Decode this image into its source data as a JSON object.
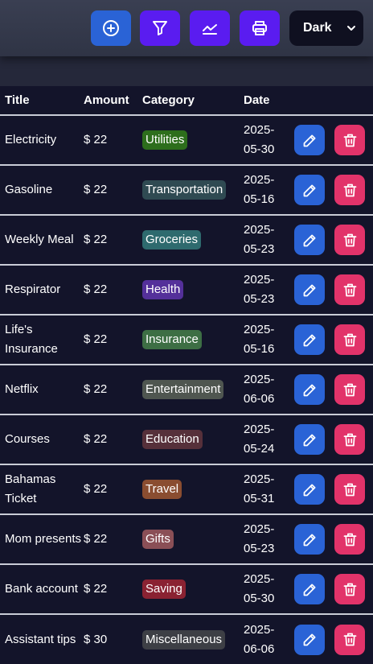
{
  "toolbar": {
    "buttons": [
      {
        "name": "add",
        "icon": "plus-circle-icon",
        "color": "#2a63d6"
      },
      {
        "name": "filter",
        "icon": "filter-icon",
        "color": "#5a1cf0"
      },
      {
        "name": "chart",
        "icon": "chart-line-icon",
        "color": "#5a1cf0"
      },
      {
        "name": "print",
        "icon": "printer-icon",
        "color": "#5a1cf0"
      }
    ],
    "theme_select": {
      "value": "Dark",
      "icon": "chevron-down-icon"
    }
  },
  "table": {
    "headers": {
      "title": "Title",
      "amount": "Amount",
      "category": "Category",
      "date": "Date"
    },
    "rows": [
      {
        "title": "Electricity",
        "amount": "$ 22",
        "category": "Utilities",
        "category_color": "#2d6e1c",
        "date_year": "2025-",
        "date_md": "05-30"
      },
      {
        "title": "Gasoline",
        "amount": "$ 22",
        "category": "Transportation",
        "category_color": "#2f4a52",
        "date_year": "2025-",
        "date_md": "05-16"
      },
      {
        "title": "Weekly Meal",
        "amount": "$ 22",
        "category": "Groceries",
        "category_color": "#2e6a6e",
        "date_year": "2025-",
        "date_md": "05-23"
      },
      {
        "title": "Respirator",
        "amount": "$ 22",
        "category": "Health",
        "category_color": "#54309a",
        "date_year": "2025-",
        "date_md": "05-23"
      },
      {
        "title": "Life's Insurance",
        "amount": "$ 22",
        "category": "Insurance",
        "category_color": "#3d6e44",
        "date_year": "2025-",
        "date_md": "05-16"
      },
      {
        "title": "Netflix",
        "amount": "$ 22",
        "category": "Entertainment",
        "category_color": "#4f5650",
        "date_year": "2025-",
        "date_md": "06-06"
      },
      {
        "title": "Courses",
        "amount": "$ 22",
        "category": "Education",
        "category_color": "#56303a",
        "date_year": "2025-",
        "date_md": "05-24"
      },
      {
        "title": "Bahamas Ticket",
        "amount": "$ 22",
        "category": "Travel",
        "category_color": "#8a4d30",
        "date_year": "2025-",
        "date_md": "05-31"
      },
      {
        "title": "Mom presents",
        "amount": "$ 22",
        "category": "Gifts",
        "category_color": "#8a4f56",
        "date_year": "2025-",
        "date_md": "05-23"
      },
      {
        "title": "Bank account",
        "amount": "$ 22",
        "category": "Saving",
        "category_color": "#8a2232",
        "date_year": "2025-",
        "date_md": "05-30"
      },
      {
        "title": "Assistant tips",
        "amount": "$ 30",
        "category": "Miscellaneous",
        "category_color": "#3d3f45",
        "date_year": "2025-",
        "date_md": "06-06"
      }
    ],
    "row_actions": {
      "edit_icon": "pencil-icon",
      "delete_icon": "trash-icon",
      "edit_color": "#2a63d6",
      "delete_color": "#e2336a"
    }
  }
}
